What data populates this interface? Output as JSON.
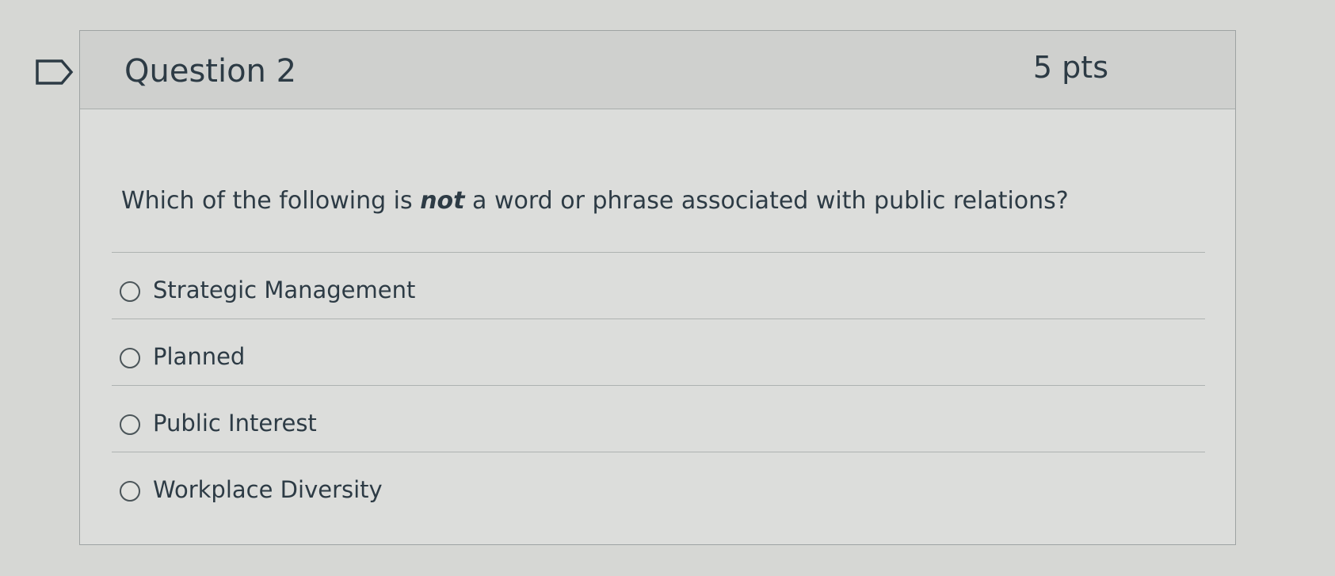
{
  "question": {
    "title": "Question 2",
    "points": "5 pts",
    "text_before": "Which of the following is ",
    "text_emphasis": "not",
    "text_after": " a word or phrase associated with public relations?"
  },
  "answers": [
    {
      "label": "Strategic Management",
      "selected": false
    },
    {
      "label": "Planned",
      "selected": false
    },
    {
      "label": "Public Interest",
      "selected": false
    },
    {
      "label": "Workplace Diversity",
      "selected": false
    }
  ],
  "icons": {
    "flag": "flag-question-icon"
  }
}
